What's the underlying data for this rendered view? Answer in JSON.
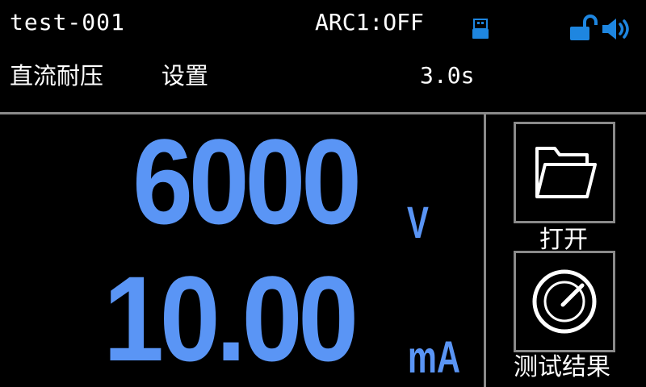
{
  "header": {
    "file_name": "test-001",
    "arc_status": "ARC1:OFF",
    "icons": [
      "usb-icon",
      "unlocked-padlock-icon",
      "speaker-icon"
    ],
    "icon_color": "#1e86e0"
  },
  "subheader": {
    "mode": "直流耐压",
    "settings": "设置",
    "time": "3.0s"
  },
  "readings": {
    "voltage": "6000",
    "voltage_unit": "V",
    "current": "10.00",
    "current_unit": "mA",
    "color": "#5a95f5"
  },
  "buttons": {
    "open": {
      "label": "打开",
      "icon": "folder-icon"
    },
    "test_result": {
      "label": "测试结果",
      "icon": "gauge-icon"
    }
  },
  "colors": {
    "background": "#000000",
    "text": "#ffffff",
    "divider": "#8a8a8a"
  }
}
